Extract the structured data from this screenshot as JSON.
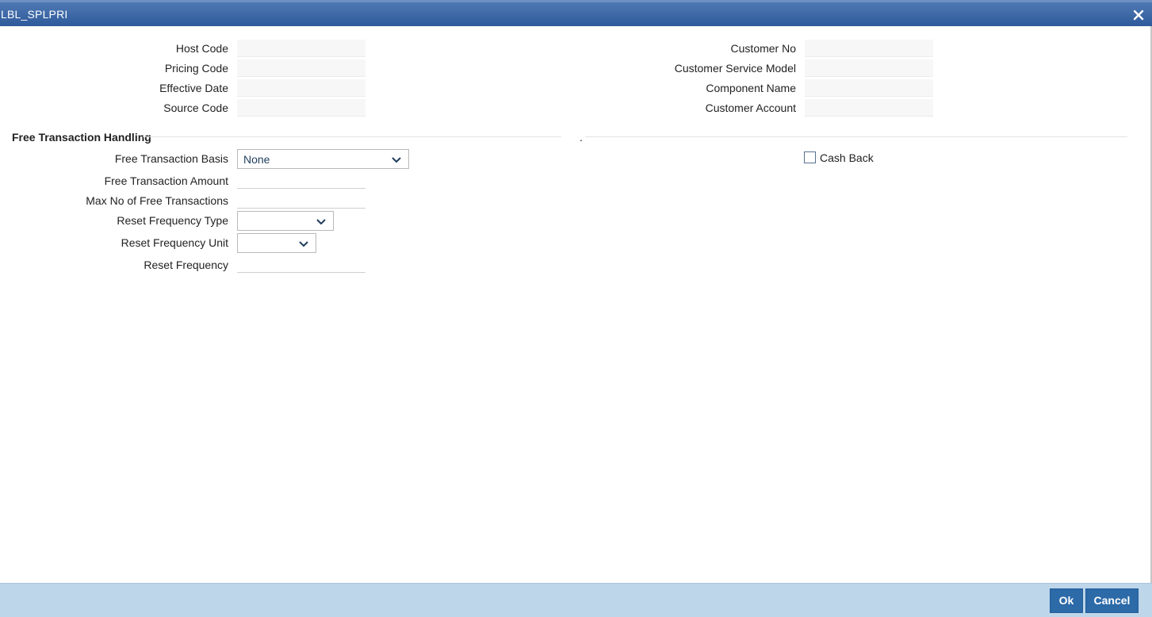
{
  "window": {
    "title": "LBL_SPLPRI",
    "close_icon": "close-icon"
  },
  "header_fields": {
    "host_code_label": "Host Code",
    "pricing_code_label": "Pricing Code",
    "effective_date_label": "Effective Date",
    "source_code_label": "Source Code",
    "customer_no_label": "Customer No",
    "customer_service_model_label": "Customer Service Model",
    "component_name_label": "Component Name",
    "customer_account_label": "Customer Account"
  },
  "section": {
    "title": "Free Transaction Handling",
    "right_marker": "."
  },
  "form": {
    "basis_label": "Free Transaction Basis",
    "basis_value": "None",
    "amount_label": "Free Transaction Amount",
    "amount_value": "",
    "max_label": "Max No of Free Transactions",
    "max_value": "",
    "reset_type_label": "Reset Frequency Type",
    "reset_type_value": "",
    "reset_unit_label": "Reset Frequency Unit",
    "reset_unit_value": "",
    "reset_freq_label": "Reset Frequency",
    "reset_freq_value": "",
    "cash_back_label": "Cash Back",
    "cash_back_checked": false
  },
  "footer": {
    "ok_label": "Ok",
    "cancel_label": "Cancel"
  },
  "colors": {
    "titlebar": "#2f5b9b",
    "footer": "#bdd6ea",
    "button": "#2c6aa8"
  }
}
